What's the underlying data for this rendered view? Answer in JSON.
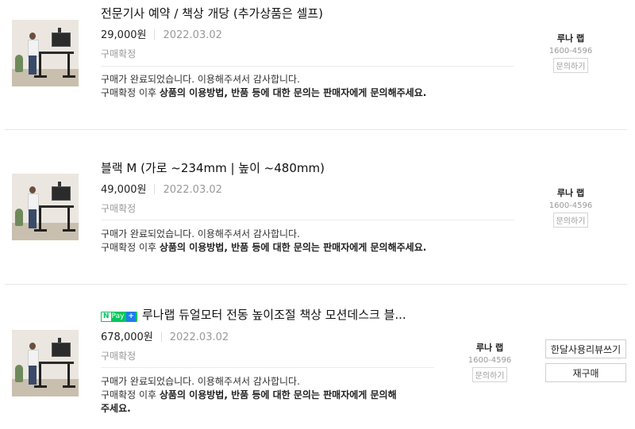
{
  "orders": [
    {
      "title": "전문기사 예약 / 책상 개당 (추가상품은 셀프)",
      "price": "29,000원",
      "date": "2022.03.02",
      "status": "구매확정",
      "message_line1": "구매가 완료되었습니다. 이용해주셔서 감사합니다.",
      "message_line2_prefix": "구매확정 이후 ",
      "message_line2_bold": "상품의 이용방법, 반품 등에 대한 문의는 판매자에게 문의해주세요.",
      "seller": {
        "name": "루나 랩",
        "phone": "1600-4596",
        "ask": "문의하기"
      }
    },
    {
      "title": "블랙 M (가로 ~234mm | 높이 ~480mm)",
      "price": "49,000원",
      "date": "2022.03.02",
      "status": "구매확정",
      "message_line1": "구매가 완료되었습니다. 이용해주셔서 감사합니다.",
      "message_line2_prefix": "구매확정 이후 ",
      "message_line2_bold": "상품의 이용방법, 반품 등에 대한 문의는 판매자에게 문의해주세요.",
      "seller": {
        "name": "루나 랩",
        "phone": "1600-4596",
        "ask": "문의하기"
      }
    },
    {
      "badge": {
        "n": "N",
        "pay": "Pay",
        "plus": "+"
      },
      "title": "루나랩 듀얼모터 전동 높이조절 책상 모션데스크 블...",
      "price": "678,000원",
      "date": "2022.03.02",
      "status": "구매확정",
      "message_line1": "구매가 완료되었습니다. 이용해주셔서 감사합니다.",
      "message_line2_prefix": "구매확정 이후 ",
      "message_line2_bold": "상품의 이용방법, 반품 등에 대한 문의는 판매자에게 문의해",
      "message_line3_bold": "주세요.",
      "seller": {
        "name": "루나 랩",
        "phone": "1600-4596",
        "ask": "문의하기"
      },
      "buttons": {
        "review": "한달사용리뷰쓰기",
        "rebuy": "재구매"
      }
    }
  ],
  "colors": {
    "npay_green": "#03c75a",
    "npay_plus_blue": "#1e7cf2",
    "muted_text": "#999999"
  }
}
